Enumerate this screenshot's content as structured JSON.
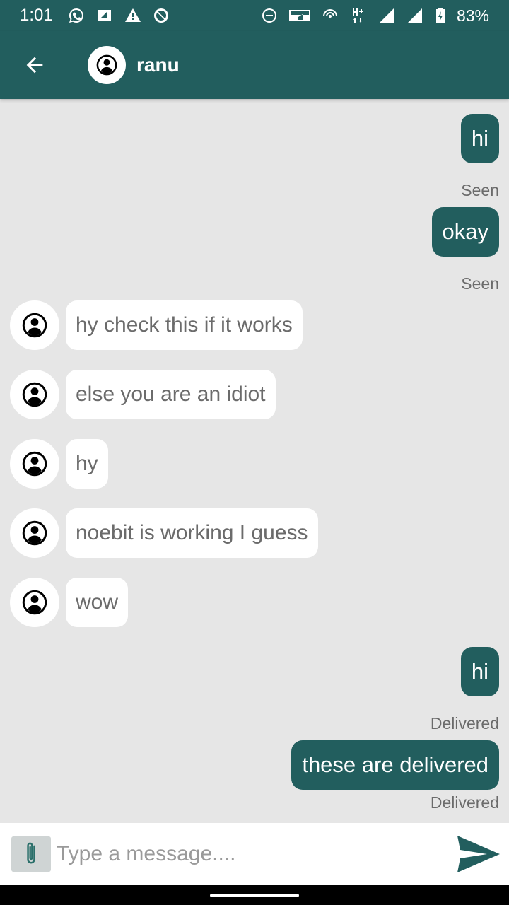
{
  "status_bar": {
    "time": "1:01",
    "battery": "83%",
    "left_icons": [
      "whatsapp-icon",
      "sim-icon",
      "warning-icon",
      "blocked-icon"
    ],
    "right_icons": [
      "do-not-disturb-icon",
      "volte-icon",
      "hotspot-icon",
      "network-hplus-icon",
      "signal-icon",
      "signal-icon",
      "battery-charging-icon"
    ]
  },
  "header": {
    "contact_name": "ranu",
    "color": "#225e5e"
  },
  "messages": [
    {
      "direction": "out",
      "text": "hi",
      "status": "Seen"
    },
    {
      "direction": "out",
      "text": "okay",
      "status": "Seen"
    },
    {
      "direction": "in",
      "text": "hy check this if it works"
    },
    {
      "direction": "in",
      "text": "else you are an idiot"
    },
    {
      "direction": "in",
      "text": "hy"
    },
    {
      "direction": "in",
      "text": "noebit is working I guess"
    },
    {
      "direction": "in",
      "text": "wow"
    },
    {
      "direction": "out",
      "text": "hi",
      "status": "Delivered"
    },
    {
      "direction": "out",
      "text": "these are delivered",
      "status": "Delivered"
    }
  ],
  "composer": {
    "placeholder": "Type a message....",
    "value": ""
  },
  "colors": {
    "accent": "#225e5e",
    "background": "#e6e6e6",
    "incoming_bubble": "#ffffff",
    "status_text": "#6b6b6b"
  }
}
